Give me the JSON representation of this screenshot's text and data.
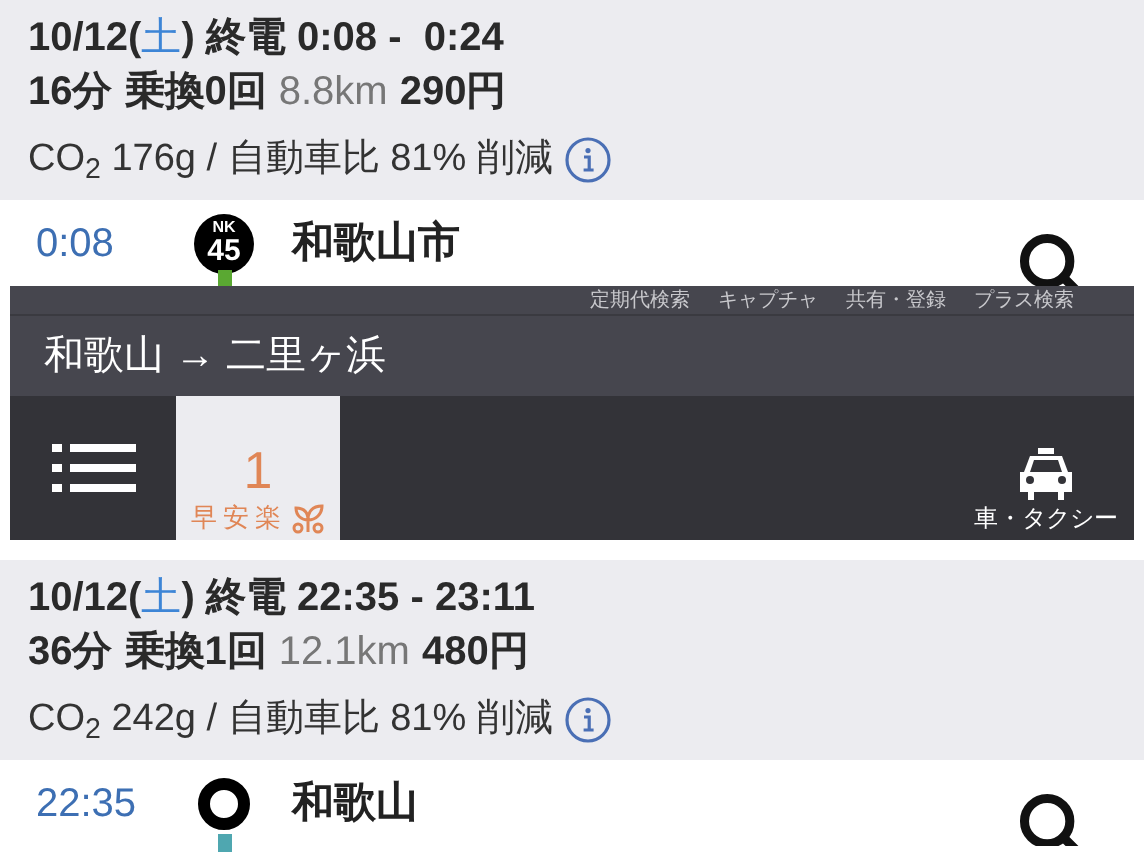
{
  "routes": [
    {
      "date_prefix": "10/12(",
      "weekday": "土",
      "date_suffix": ")",
      "label": "終電",
      "time": "0:08 -  0:24",
      "duration": "16分",
      "transfers": "乗換0回",
      "distance": "8.8km",
      "fare": "290円",
      "co2": "CO$_{2}$ 176g / 自動車比 81% 削減",
      "first_stop": {
        "time": "0:08",
        "marker": {
          "kind": "numbered",
          "line": "NK",
          "number": "45"
        },
        "name": "和歌山市",
        "color": "#5aa832"
      }
    },
    {
      "date_prefix": "10/12(",
      "weekday": "土",
      "date_suffix": ")",
      "label": "終電",
      "time": "22:35 - 23:11",
      "duration": "36分",
      "transfers": "乗換1回",
      "distance": "12.1km",
      "fare": "480円",
      "co2": "CO$_{2}$ 242g / 自動車比 81% 削減",
      "first_stop": {
        "time": "22:35",
        "marker": {
          "kind": "ring"
        },
        "name": "和歌山",
        "color": "#4fa7b0"
      }
    }
  ],
  "header": {
    "menu_links": [
      "定期代検索",
      "キャプチャ",
      "共有・登録",
      "プラス検索"
    ],
    "title": "和歌山 → 二里ヶ浜",
    "tabs": [
      {
        "kind": "list",
        "selected": false
      },
      {
        "kind": "route",
        "number": "1",
        "label": "早安楽",
        "selected": true
      },
      {
        "kind": "car",
        "label": "車・タクシー",
        "selected": false
      }
    ]
  }
}
